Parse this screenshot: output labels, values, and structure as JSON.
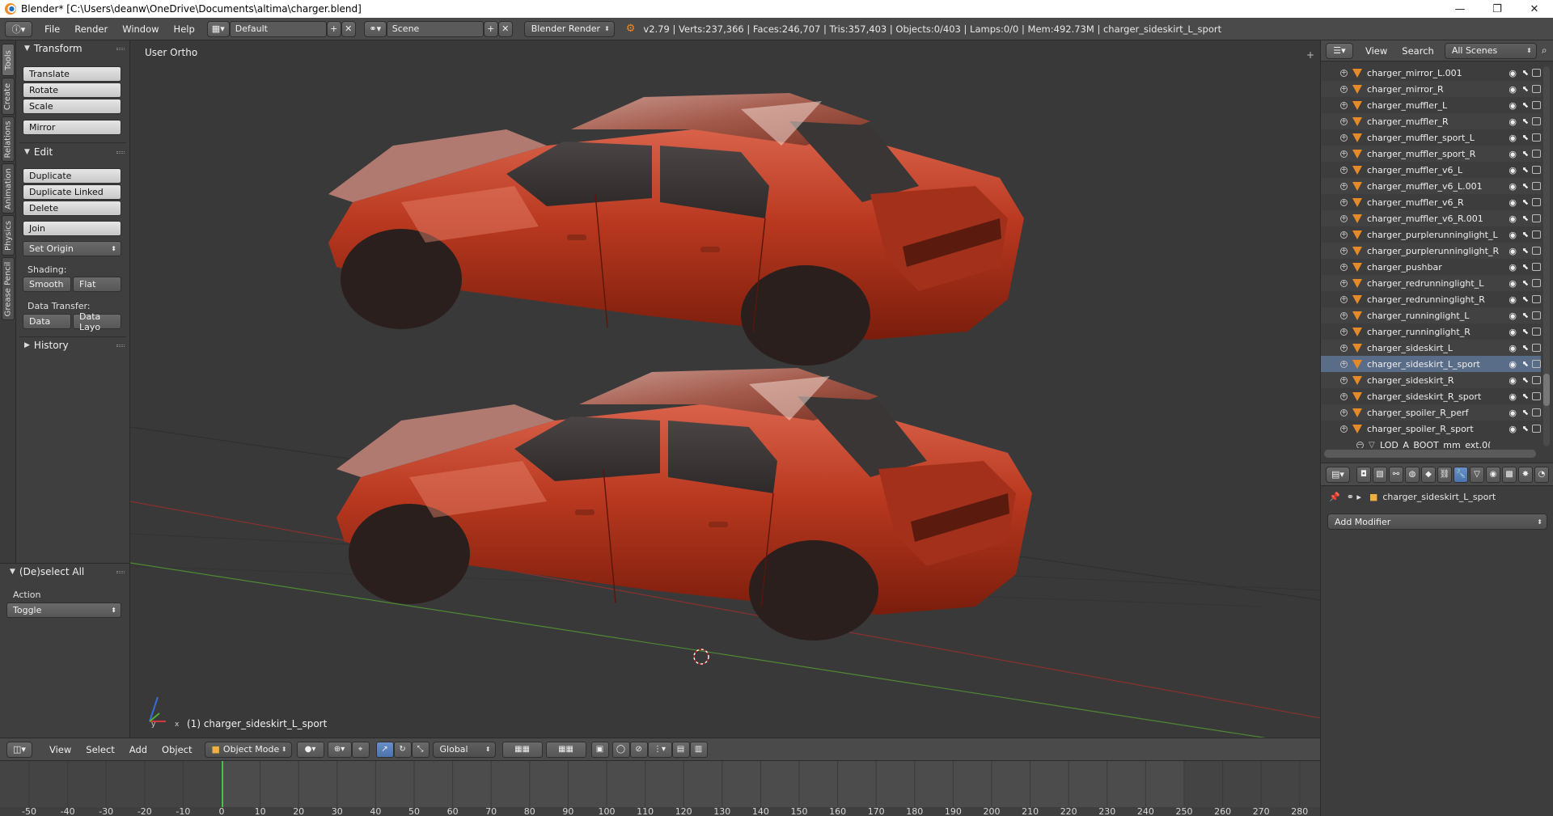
{
  "window": {
    "title": "Blender* [C:\\Users\\deanw\\OneDrive\\Documents\\altima\\charger.blend]",
    "minimize": "—",
    "restore": "❐",
    "close": "✕"
  },
  "info_header": {
    "menus": [
      "File",
      "Render",
      "Window",
      "Help"
    ],
    "layout": "Default",
    "scene": "Scene",
    "render_engine": "Blender Render",
    "stats": "v2.79 | Verts:237,366 | Faces:246,707 | Tris:357,403 | Objects:0/403 | Lamps:0/0 | Mem:492.73M | charger_sideskirt_L_sport"
  },
  "tool_tabs": [
    "Tools",
    "Create",
    "Relations",
    "Animation",
    "Physics",
    "Grease Pencil"
  ],
  "tool_shelf": {
    "transform": {
      "title": "Transform",
      "buttons": [
        "Translate",
        "Rotate",
        "Scale",
        "Mirror"
      ]
    },
    "edit": {
      "title": "Edit",
      "buttons": [
        "Duplicate",
        "Duplicate Linked",
        "Delete",
        "Join"
      ],
      "set_origin": "Set Origin",
      "shading_label": "Shading:",
      "smooth": "Smooth",
      "flat": "Flat",
      "data_transfer_label": "Data Transfer:",
      "data": "Data",
      "data_layout": "Data Layo"
    },
    "history": {
      "title": "History"
    }
  },
  "operator_panel": {
    "title": "(De)select All",
    "action_label": "Action",
    "action_value": "Toggle"
  },
  "viewport": {
    "view_label": "User Ortho",
    "active_object_label": "(1) charger_sideskirt_L_sport",
    "axis_x": "x",
    "axis_y": "y"
  },
  "view3d_header": {
    "menus": [
      "View",
      "Select",
      "Add",
      "Object"
    ],
    "mode": "Object Mode",
    "orientation": "Global"
  },
  "timeline": {
    "ticks": [
      -50,
      -40,
      -30,
      -20,
      -10,
      0,
      10,
      20,
      30,
      40,
      50,
      60,
      70,
      80,
      90,
      100,
      110,
      120,
      130,
      140,
      150,
      160,
      170,
      180,
      190,
      200,
      210,
      220,
      230,
      240,
      250,
      260,
      270,
      280
    ],
    "current_frame": 0
  },
  "outliner": {
    "view": "View",
    "search": "Search",
    "filter": "All Scenes",
    "items": [
      {
        "name": "charger_mirror_L.001",
        "selected": false
      },
      {
        "name": "charger_mirror_R",
        "selected": false
      },
      {
        "name": "charger_muffler_L",
        "selected": false
      },
      {
        "name": "charger_muffler_R",
        "selected": false
      },
      {
        "name": "charger_muffler_sport_L",
        "selected": false
      },
      {
        "name": "charger_muffler_sport_R",
        "selected": false
      },
      {
        "name": "charger_muffler_v6_L",
        "selected": false
      },
      {
        "name": "charger_muffler_v6_L.001",
        "selected": false
      },
      {
        "name": "charger_muffler_v6_R",
        "selected": false
      },
      {
        "name": "charger_muffler_v6_R.001",
        "selected": false
      },
      {
        "name": "charger_purplerunninglight_L",
        "selected": false
      },
      {
        "name": "charger_purplerunninglight_R",
        "selected": false
      },
      {
        "name": "charger_pushbar",
        "selected": false
      },
      {
        "name": "charger_redrunninglight_L",
        "selected": false
      },
      {
        "name": "charger_redrunninglight_R",
        "selected": false
      },
      {
        "name": "charger_runninglight_L",
        "selected": false
      },
      {
        "name": "charger_runninglight_R",
        "selected": false
      },
      {
        "name": "charger_sideskirt_L",
        "selected": false
      },
      {
        "name": "charger_sideskirt_L_sport",
        "selected": true
      },
      {
        "name": "charger_sideskirt_R",
        "selected": false
      },
      {
        "name": "charger_sideskirt_R_sport",
        "selected": false
      },
      {
        "name": "charger_spoiler_R_perf",
        "selected": false
      },
      {
        "name": "charger_spoiler_R_sport",
        "selected": false
      }
    ],
    "child_item": "LOD_A_BOOT_mm_ext.0("
  },
  "properties": {
    "object_name": "charger_sideskirt_L_sport",
    "add_modifier": "Add Modifier"
  },
  "colors": {
    "car_body": "#b8381f",
    "accent_blue": "#5680c2",
    "grid_red": "#8a3030",
    "grid_green": "#4e8a32"
  }
}
